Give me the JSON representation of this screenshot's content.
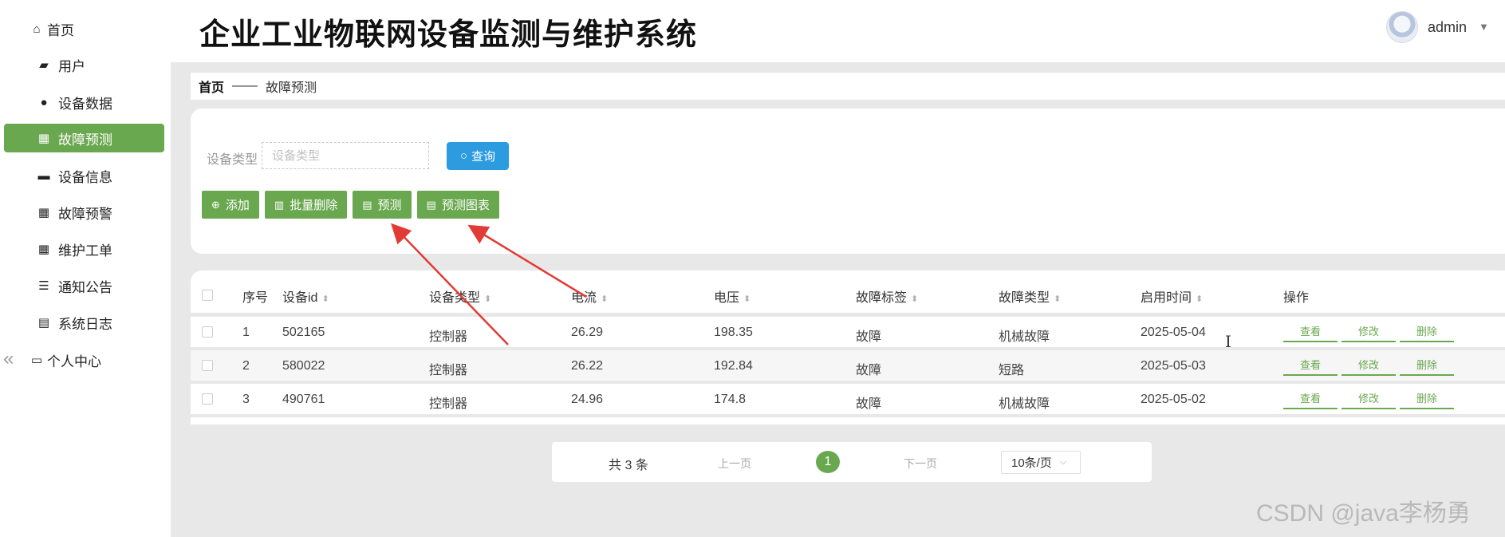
{
  "app": {
    "title": "企业工业物联网设备监测与维护系统"
  },
  "user": {
    "name": "admin"
  },
  "sidebar": {
    "home": "首页",
    "items": [
      {
        "label": "用户",
        "icon": "wallet-icon"
      },
      {
        "label": "设备数据",
        "icon": "map-pin-icon"
      },
      {
        "label": "故障预测",
        "icon": "grid-icon",
        "active": true
      },
      {
        "label": "设备信息",
        "icon": "briefcase-icon"
      },
      {
        "label": "故障预警",
        "icon": "grid-icon"
      },
      {
        "label": "维护工单",
        "icon": "grid-icon"
      },
      {
        "label": "通知公告",
        "icon": "sliders-icon"
      },
      {
        "label": "系统日志",
        "icon": "clipboard-icon"
      }
    ],
    "personal": "个人中心"
  },
  "breadcrumb": {
    "home": "首页",
    "separator": "——",
    "current": "故障预测"
  },
  "search": {
    "label": "设备类型",
    "placeholder": "设备类型",
    "button": "查询"
  },
  "toolbar": {
    "add": "添加",
    "batch_delete": "批量删除",
    "predict": "预测",
    "predict_chart": "预测图表"
  },
  "table": {
    "headers": {
      "index": "序号",
      "device_id": "设备id",
      "device_type": "设备类型",
      "current": "电流",
      "voltage": "电压",
      "fault_label": "故障标签",
      "fault_type": "故障类型",
      "start_time": "启用时间",
      "actions": "操作"
    },
    "rows": [
      {
        "index": "1",
        "device_id": "502165",
        "device_type": "控制器",
        "current": "26.29",
        "voltage": "198.35",
        "fault_label": "故障",
        "fault_type": "机械故障",
        "start_time": "2025-05-04"
      },
      {
        "index": "2",
        "device_id": "580022",
        "device_type": "控制器",
        "current": "26.22",
        "voltage": "192.84",
        "fault_label": "故障",
        "fault_type": "短路",
        "start_time": "2025-05-03"
      },
      {
        "index": "3",
        "device_id": "490761",
        "device_type": "控制器",
        "current": "24.96",
        "voltage": "174.8",
        "fault_label": "故障",
        "fault_type": "机械故障",
        "start_time": "2025-05-02"
      }
    ],
    "actions": {
      "view": "查看",
      "edit": "修改",
      "delete": "删除"
    }
  },
  "pagination": {
    "total": "共 3 条",
    "prev": "上一页",
    "page": "1",
    "next": "下一页",
    "page_size": "10条/页"
  },
  "watermark": "CSDN @java李杨勇",
  "colors": {
    "accent_green": "#6aa84f",
    "query_blue": "#2d9be0",
    "annotation_red": "#e23b36"
  }
}
